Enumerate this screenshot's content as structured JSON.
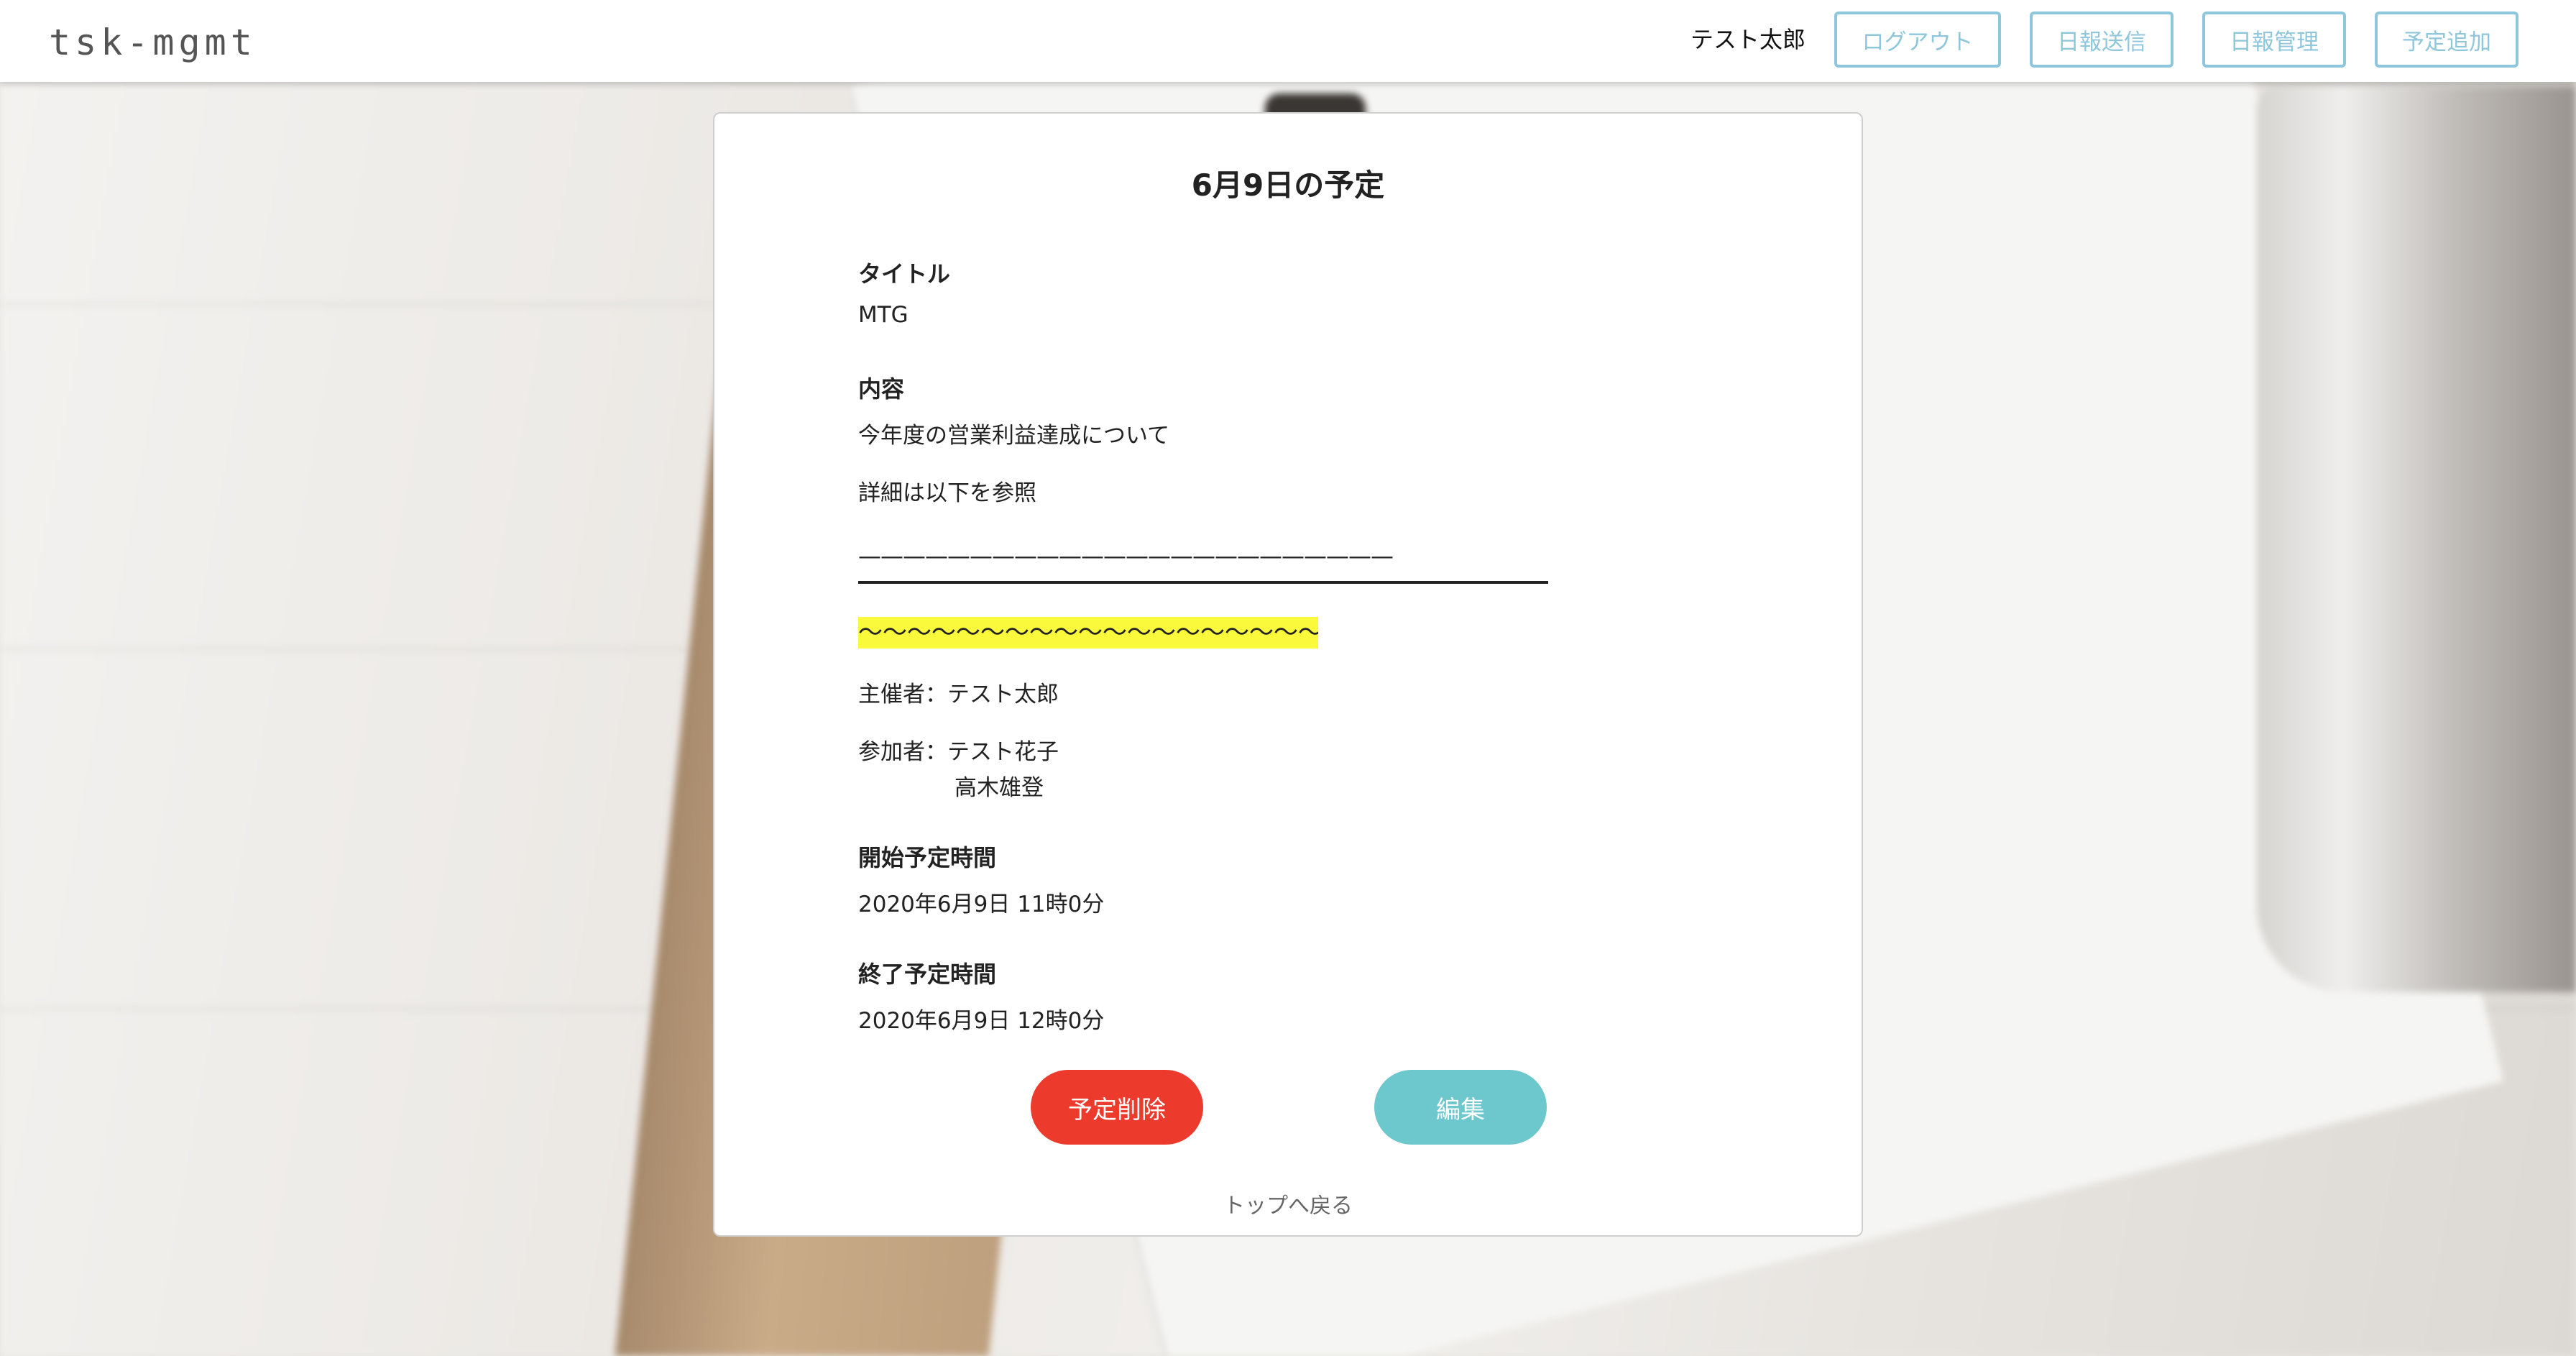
{
  "header": {
    "logo": "tsk-mgmt",
    "user_name": "テスト太郎",
    "nav": {
      "logout": "ログアウト",
      "send_report": "日報送信",
      "manage_report": "日報管理",
      "add_schedule": "予定追加"
    }
  },
  "card": {
    "title": "6月9日の予定",
    "title_label": "タイトル",
    "title_value": "MTG",
    "content_label": "内容",
    "content_line1": "今年度の営業利益達成について",
    "content_line2": "詳細は以下を参照",
    "content_dashes": "————————————————————————",
    "content_waves": "〜〜〜〜〜〜〜〜〜〜〜〜〜〜〜〜〜〜〜〜〜",
    "organizer": "主催者：テスト太郎",
    "participants_line1": "参加者：テスト花子",
    "participants_line2": "高木雄登",
    "start_label": "開始予定時間",
    "start_value": "2020年6月9日 11時0分",
    "end_label": "終了予定時間",
    "end_value": "2020年6月9日 12時0分",
    "delete_button": "予定削除",
    "edit_button": "編集",
    "back_link": "トップへ戻る"
  },
  "colors": {
    "nav_accent": "#8ec6dc",
    "delete": "#ec3b2c",
    "edit": "#6cc8cd",
    "highlight": "#fbf93c"
  }
}
